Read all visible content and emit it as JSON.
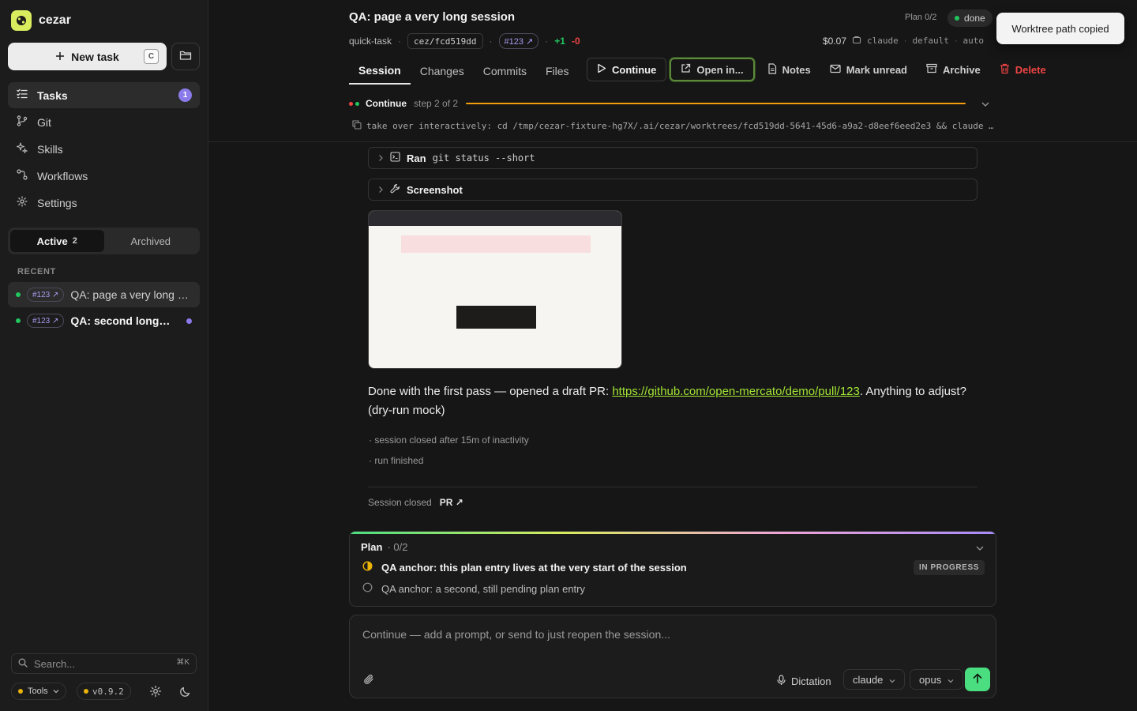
{
  "sidebar": {
    "brand": "cezar",
    "new_task": "New task",
    "new_task_shortcut": "C",
    "nav": [
      {
        "label": "Tasks",
        "badge": "1"
      },
      {
        "label": "Git"
      },
      {
        "label": "Skills"
      },
      {
        "label": "Workflows"
      },
      {
        "label": "Settings"
      }
    ],
    "segments": {
      "active_label": "Active",
      "active_count": "2",
      "archived_label": "Archived"
    },
    "recent_label": "RECENT",
    "recent": [
      {
        "pr": "#123 ↗",
        "title": "QA: page a very long session"
      },
      {
        "pr": "#123 ↗",
        "title": "QA: second long session"
      }
    ],
    "search_placeholder": "Search...",
    "search_shortcut": "⌘K",
    "tools_label": "Tools",
    "version": "v0.9.2"
  },
  "task": {
    "title": "QA: page a very long session",
    "type": "quick-task",
    "branch": "cez/fcd519dd",
    "pr": "#123 ↗",
    "additions": "+1",
    "deletions": "-0",
    "plan_count": "Plan 0/2",
    "status": "done",
    "cost": "$0.07",
    "agent": "claude",
    "profile": "default",
    "mode": "auto"
  },
  "toast": "Worktree path copied",
  "tabs": [
    "Session",
    "Changes",
    "Commits",
    "Files"
  ],
  "actions": {
    "continue": "Continue",
    "open_in": "Open in...",
    "notes": "Notes",
    "mark_unread": "Mark unread",
    "archive": "Archive",
    "delete": "Delete"
  },
  "progress": {
    "label": "Continue",
    "step": "step 2 of 2",
    "value": 1.0
  },
  "takeover_command": "take over interactively: cd /tmp/cezar-fixture-hg7X/.ai/cezar/worktrees/fcd519dd-5641-45d6-a9a2-d8eef6eed2e3 && claude …",
  "session": {
    "tool_ran_label": "Ran",
    "tool_ran_cmd": "git status --short",
    "tool_screenshot_label": "Screenshot",
    "message_prefix": "Done with the first pass — opened a draft PR: ",
    "message_link": "https://github.com/open-mercato/demo/pull/123",
    "message_suffix": ". Anything to adjust? (dry-run mock)",
    "system_1": "· session closed after 15m of inactivity",
    "system_2": "· run finished",
    "closed_label": "Session closed",
    "closed_pr": "PR ↗"
  },
  "plan": {
    "title": "Plan",
    "count": "· 0/2",
    "items": [
      {
        "text": "QA anchor: this plan entry lives at the very start of the session",
        "status": "IN PROGRESS"
      },
      {
        "text": "QA anchor: a second, still pending plan entry"
      }
    ]
  },
  "composer": {
    "placeholder": "Continue — add a prompt, or send to just reopen the session...",
    "dictation": "Dictation",
    "agent": "claude",
    "model": "opus"
  },
  "colors": {
    "accent_green": "#4ade80",
    "brand_lime": "#d9ec5e",
    "badge_purple": "#8b7bea",
    "progress_amber": "#f59e0b",
    "danger_red": "#ef4444"
  }
}
